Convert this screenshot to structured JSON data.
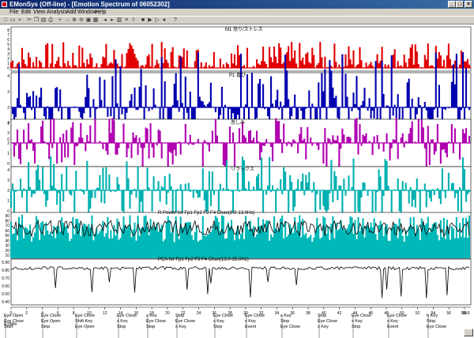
{
  "window": {
    "title": "EMonSys (Off-line) - [Emotion Spectrum of 06052302]",
    "min": "_",
    "max": "□",
    "close": "×"
  },
  "menu": [
    {
      "label": "File"
    },
    {
      "label": "Edit"
    },
    {
      "label": "View"
    },
    {
      "label": "Analysis"
    },
    {
      "label": "Add"
    },
    {
      "label": "Window"
    },
    {
      "label": "Help"
    }
  ],
  "toolbar": [
    {
      "icon": "new-icon",
      "glyph": "□"
    },
    {
      "icon": "open-icon",
      "glyph": "▭"
    },
    {
      "icon": "save-icon",
      "glyph": "▪"
    },
    {
      "icon": "cut-icon",
      "glyph": "✂"
    },
    {
      "icon": "copy-icon",
      "glyph": "❐"
    },
    {
      "icon": "paste-icon",
      "glyph": "▤"
    },
    {
      "icon": "print-icon",
      "glyph": "⎙"
    },
    {
      "icon": "plus-icon",
      "glyph": "+"
    },
    {
      "icon": "arrow-icon",
      "glyph": "→"
    },
    {
      "icon": "zoom-icon",
      "glyph": "⊕"
    },
    {
      "icon": "zoomout-icon",
      "glyph": "⊖"
    },
    {
      "icon": "fit-icon",
      "glyph": "▣"
    },
    {
      "icon": "grid-icon",
      "glyph": "▦"
    },
    {
      "icon": "left-icon",
      "glyph": "◂"
    },
    {
      "icon": "right-icon",
      "glyph": "▸"
    },
    {
      "icon": "chart-icon",
      "glyph": "▥"
    },
    {
      "icon": "list-icon",
      "glyph": "≡"
    },
    {
      "icon": "mark-icon",
      "glyph": "◊"
    },
    {
      "icon": "stop-icon",
      "glyph": "■"
    },
    {
      "icon": "play-icon",
      "glyph": "▶"
    },
    {
      "icon": "forward-icon",
      "glyph": "▷"
    },
    {
      "icon": "record-icon",
      "glyph": "●"
    },
    {
      "icon": "help-icon",
      "glyph": "?"
    }
  ],
  "panels": [
    {
      "title": "M1 怒り/ストレス",
      "color": "#e00000"
    },
    {
      "title": "P1 喜び",
      "color": "#0000b0"
    },
    {
      "title": "悲しみ",
      "color": "#b000b0"
    },
    {
      "title": "リラックス",
      "color": "#00b0b0"
    },
    {
      "title": "R Power for Fp1 Fp2 F3 F4 Chan(8.0-13.0Hz)",
      "color": "#000000"
    },
    {
      "title": "PCA for Fp1 Fp2 F3 F4 Chan(13.0-25.0Hz)",
      "color": "#000000"
    }
  ],
  "axes": {
    "y1": [
      "8",
      "7",
      "6",
      "5",
      "4",
      "3",
      "2",
      "1",
      "0"
    ],
    "y2": [
      "4",
      "3",
      "2",
      "1",
      "0"
    ],
    "y5": [
      "90",
      "80",
      "70",
      "60",
      "50",
      "40",
      "30",
      "20",
      "10"
    ],
    "y6": [
      "0.90",
      "0.80",
      "0.70",
      "0.60",
      "0.50",
      "0.40"
    ],
    "x": [
      "0",
      "2",
      "4",
      "6",
      "8",
      "10",
      "12",
      "14",
      "16",
      "18",
      "20",
      "22",
      "24",
      "26",
      "28",
      "30",
      "32",
      "34",
      "36",
      "38",
      "40",
      "42",
      "44",
      "46",
      "48",
      "50",
      "52",
      "54",
      "56",
      "58"
    ],
    "xunit": "0.0Min",
    "xend": "55.6"
  },
  "events": [
    {
      "l1": "Eye Open",
      "l2": "Eye Close",
      "l3": "Start"
    },
    {
      "l1": "Eye Close",
      "l2": "Eye Open",
      "l3": "Stop"
    },
    {
      "l1": "Eye Close",
      "l2": "Shift Key",
      "l3": "Eye Open"
    },
    {
      "l1": "Eye Close",
      "l2": "s Key",
      "l3": "Stop"
    },
    {
      "l1": "s Key",
      "l2": "Eye Close",
      "l3": "Stop"
    },
    {
      "l1": "Stop",
      "l2": "Eye Close",
      "l3": "s Key"
    },
    {
      "l1": "Eye Close",
      "l2": "s Key",
      "l3": "Stop"
    },
    {
      "l1": "Eye Close",
      "l2": "s Key",
      "l3": "Event"
    },
    {
      "l1": "s Key",
      "l2": "Stop",
      "l3": "Eye Close"
    },
    {
      "l1": "Stop",
      "l2": "Eye Close",
      "l3": "s Key"
    },
    {
      "l1": "Eye Close",
      "l2": "s Key",
      "l3": "Stop"
    },
    {
      "l1": "Eye Close",
      "l2": "s Key",
      "l3": "Event"
    },
    {
      "l1": "h Key",
      "l2": "Stop",
      "l3": "Eye Close"
    }
  ]
}
